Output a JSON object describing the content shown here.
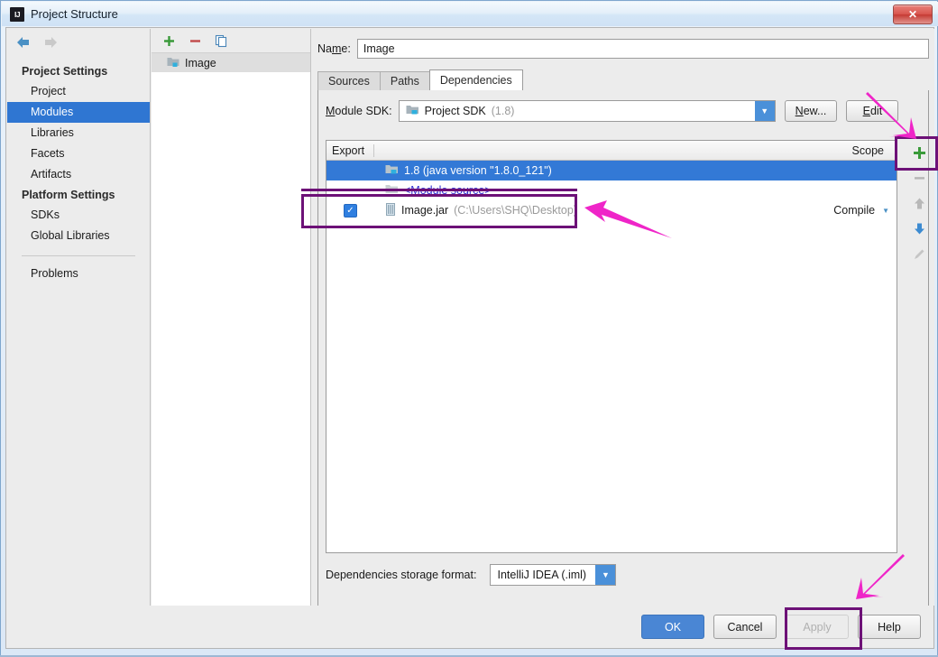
{
  "window": {
    "title": "Project Structure",
    "app_icon": "IJ",
    "close_label": "✕"
  },
  "sidebar": {
    "nav": {
      "back_icon": "arrow-left",
      "forward_icon": "arrow-right"
    },
    "groups": [
      {
        "label": "Project Settings",
        "items": [
          {
            "label": "Project",
            "selected": false
          },
          {
            "label": "Modules",
            "selected": true
          },
          {
            "label": "Libraries",
            "selected": false
          },
          {
            "label": "Facets",
            "selected": false
          },
          {
            "label": "Artifacts",
            "selected": false
          }
        ]
      },
      {
        "label": "Platform Settings",
        "items": [
          {
            "label": "SDKs",
            "selected": false
          },
          {
            "label": "Global Libraries",
            "selected": false
          }
        ]
      }
    ],
    "problems": {
      "label": "Problems"
    }
  },
  "tree_panel": {
    "toolbar": [
      {
        "icon": "plus-icon",
        "glyph": "+",
        "color": "#3a9a3a"
      },
      {
        "icon": "minus-icon",
        "glyph": "−",
        "color": "#c14a4a"
      },
      {
        "icon": "copy-icon",
        "glyph": "⧉",
        "color": "#4a86b8"
      }
    ],
    "items": [
      {
        "label": "Image",
        "icon": "module-folder-icon",
        "selected": true
      }
    ]
  },
  "content": {
    "name_label": "Name:",
    "name_label_mnemonic": "m",
    "name_value": "Image",
    "tabs": [
      {
        "label": "Sources",
        "active": false
      },
      {
        "label": "Paths",
        "active": false
      },
      {
        "label": "Dependencies",
        "active": true
      }
    ],
    "module_sdk": {
      "label": "Module SDK:",
      "label_mnemonic": "M",
      "value": "Project SDK",
      "value_suffix": "(1.8)",
      "new_button": "New...",
      "new_mnemonic": "N",
      "edit_button": "Edit",
      "edit_mnemonic": "E"
    },
    "table": {
      "columns": {
        "export": "Export",
        "scope": "Scope"
      },
      "rows": [
        {
          "export_checked": false,
          "show_checkbox": false,
          "icon": "sdk-icon",
          "name": "1.8 (java version \"1.8.0_121\")",
          "detail": "",
          "scope": "",
          "selected": true,
          "struck": false
        },
        {
          "export_checked": false,
          "show_checkbox": false,
          "icon": "source-folder-icon",
          "name": "<Module source>",
          "detail": "",
          "scope": "",
          "selected": false,
          "struck": true
        },
        {
          "export_checked": true,
          "show_checkbox": true,
          "icon": "jar-icon",
          "name": "Image.jar",
          "detail": "(C:\\Users\\SHQ\\Desktop)",
          "scope": "Compile",
          "selected": false,
          "struck": false
        }
      ]
    },
    "vtoolbar": [
      {
        "icon": "add-icon",
        "glyph": "+",
        "color": "#3a9a3a",
        "enabled": true
      },
      {
        "icon": "remove-icon",
        "glyph": "−",
        "color": "#b0b0b0",
        "enabled": false
      },
      {
        "icon": "move-up-icon",
        "glyph": "▲",
        "color": "#b8b8b8",
        "enabled": false
      },
      {
        "icon": "move-down-icon",
        "glyph": "▼",
        "color": "#3d8bd1",
        "enabled": true
      },
      {
        "icon": "edit-pencil-icon",
        "glyph": "✎",
        "color": "#bdbdbd",
        "enabled": false
      }
    ],
    "storage": {
      "label": "Dependencies storage format:",
      "value": "IntelliJ IDEA (.iml)"
    }
  },
  "footer": {
    "buttons": [
      {
        "label": "OK",
        "style": "primary"
      },
      {
        "label": "Cancel",
        "style": "normal"
      },
      {
        "label": "Apply",
        "style": "disabled"
      },
      {
        "label": "Help",
        "style": "normal"
      }
    ]
  },
  "annotations": {
    "color": "#6d1177",
    "arrow_color": "#ef25c8",
    "highlight_boxes": [
      {
        "name": "add-dependency-button-highlight"
      },
      {
        "name": "image-jar-row-highlight"
      },
      {
        "name": "apply-button-highlight"
      }
    ],
    "arrows": [
      {
        "name": "arrow-to-add-button"
      },
      {
        "name": "arrow-to-image-jar"
      },
      {
        "name": "arrow-to-apply-button"
      }
    ],
    "strikethrough": {
      "name": "module-source-strikethrough"
    }
  }
}
